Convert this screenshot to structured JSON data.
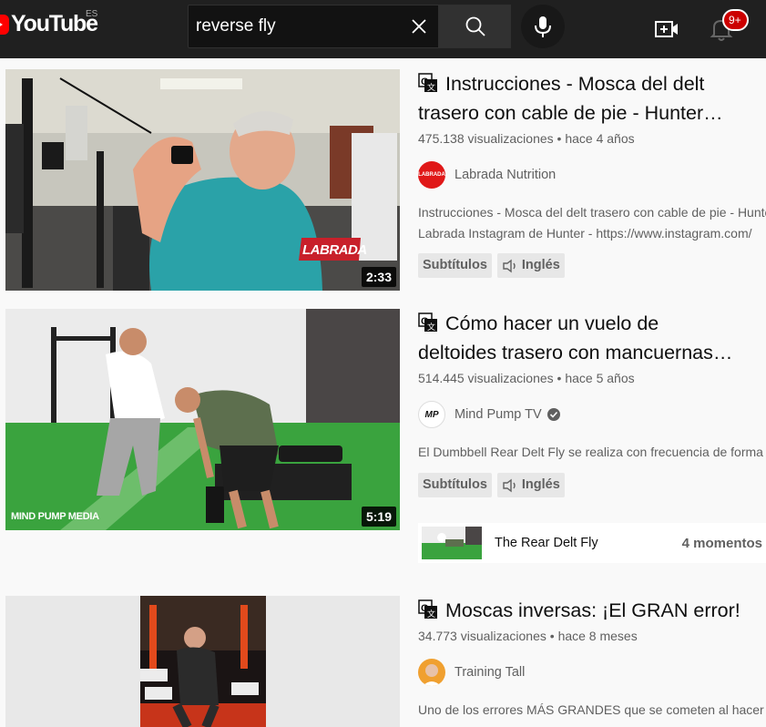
{
  "header": {
    "logo_text": "YouTube",
    "region": "ES",
    "search_value": "reverse fly",
    "notification_count": "9+"
  },
  "results": [
    {
      "title": "Instrucciones - Mosca del delt trasero con cable de pie - Hunter…",
      "title_line1": "Instrucciones - Mosca del delt",
      "title_line2": "trasero con cable de pie - Hunter…",
      "views": "475.138 visualizaciones",
      "age": "hace 4 años",
      "channel": "Labrada Nutrition",
      "description_line1": "Instrucciones - Mosca del delt trasero con cable de pie - Hunter",
      "description_line2": "Labrada Instagram de Hunter - https://www.instagram.com/",
      "badges": [
        "Subtítulos",
        "Inglés"
      ],
      "duration": "2:33",
      "thumb_watermark": "LABRADA",
      "avatar_text": "LABRADA"
    },
    {
      "title": "Cómo hacer un vuelo de deltoides trasero con mancuernas…",
      "title_line1": "Cómo hacer un vuelo de",
      "title_line2": "deltoides trasero con mancuernas…",
      "views": "514.445 visualizaciones",
      "age": "hace 5 años",
      "channel": "Mind Pump TV",
      "description_line1": "El Dumbbell Rear Delt Fly se realiza con frecuencia de forma",
      "badges": [
        "Subtítulos",
        "Inglés"
      ],
      "duration": "5:19",
      "thumb_watermark": "MIND PUMP MEDIA",
      "avatar_text": "MP",
      "moment_title": "The Rear Delt Fly",
      "moment_count": "4 momentos"
    },
    {
      "title": "Moscas inversas: ¡El GRAN error!",
      "views": "34.773 visualizaciones",
      "age": "hace 8 meses",
      "channel": "Training Tall",
      "description_line1": "Uno de los errores MÁS GRANDES que se cometen al hacer"
    }
  ],
  "colors": {
    "header_bg": "#202020",
    "logo_red": "#ff0000",
    "badge_red": "#cc0000",
    "page_bg": "#f9f9f9",
    "text_primary": "#0f0f0f",
    "text_secondary": "#606060"
  },
  "icons": [
    "youtube-logo-icon",
    "close-icon",
    "search-icon",
    "microphone-icon",
    "create-video-icon",
    "bell-icon",
    "translate-icon",
    "closed-captions-icon",
    "audio-language-icon",
    "verified-icon"
  ]
}
